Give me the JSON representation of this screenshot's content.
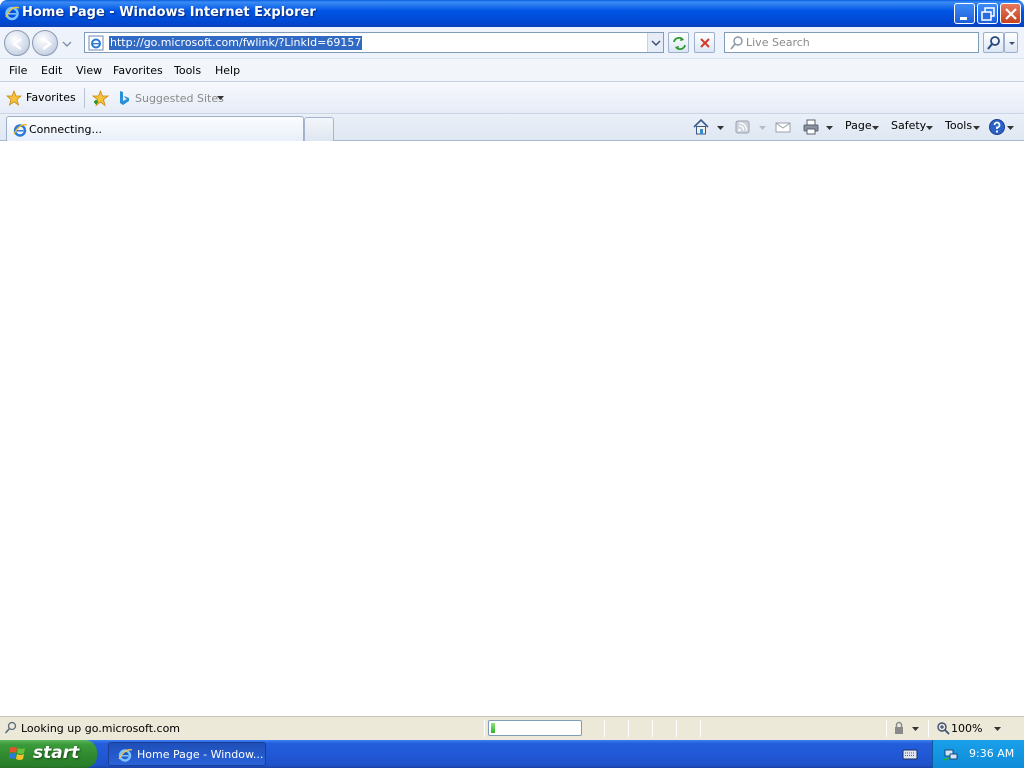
{
  "window": {
    "title": "Home Page - Windows Internet Explorer"
  },
  "address_bar": {
    "url": "http://go.microsoft.com/fwlink/?LinkId=69157"
  },
  "search": {
    "placeholder": "Live Search"
  },
  "menu": {
    "items": [
      "File",
      "Edit",
      "View",
      "Favorites",
      "Tools",
      "Help"
    ]
  },
  "favorites_bar": {
    "favorites_label": "Favorites",
    "suggested_sites_label": "Suggested Sites"
  },
  "tab": {
    "title": "Connecting..."
  },
  "command_bar": {
    "page_label": "Page",
    "safety_label": "Safety",
    "tools_label": "Tools"
  },
  "status_bar": {
    "text": "Looking up go.microsoft.com",
    "progress": 0.05,
    "zoom": "100%"
  },
  "taskbar": {
    "start_label": "start",
    "window_button_label": "Home Page - Window...",
    "clock": "9:36 AM"
  },
  "colors": {
    "titlebar": "#0055e5",
    "taskbar": "#245edb",
    "start_button": "#3c9c3c",
    "url_selection": "#316ac5"
  }
}
